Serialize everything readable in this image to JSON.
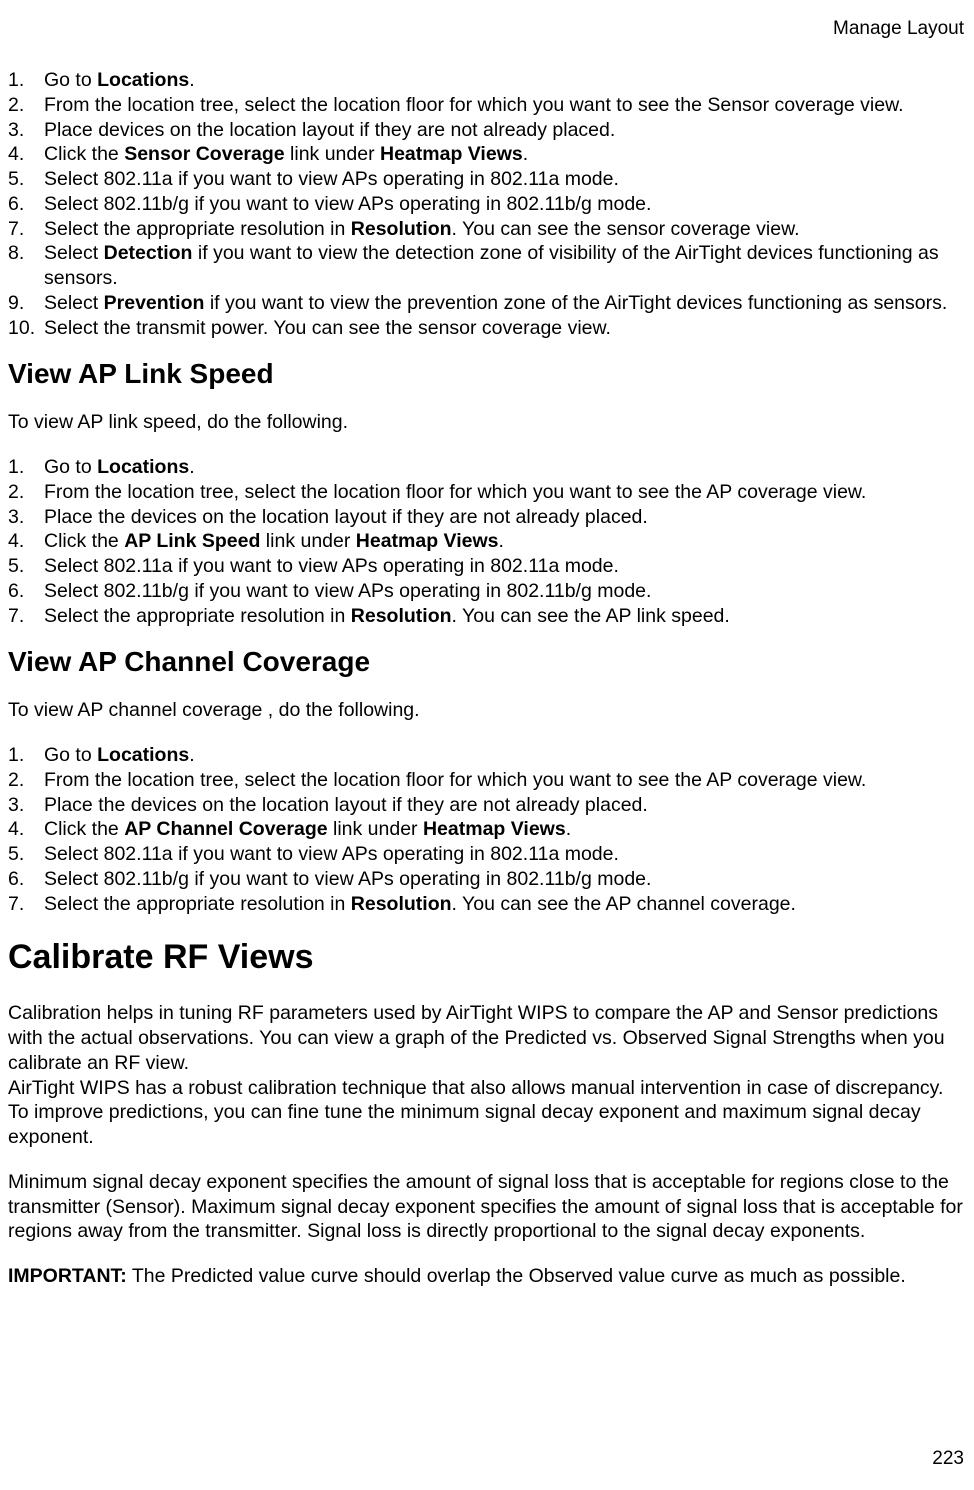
{
  "header": {
    "right": "Manage Layout"
  },
  "list1": {
    "i1": {
      "pre": "Go to ",
      "b": "Locations",
      "post": "."
    },
    "i2": "From the location tree, select the location floor for which you want to see the Sensor coverage view.",
    "i3": "Place devices on the location layout if they are not already placed.",
    "i4": {
      "pre": "Click the ",
      "b1": "Sensor Coverage",
      "mid": " link under ",
      "b2": "Heatmap Views",
      "post": "."
    },
    "i5": "Select 802.11a if you want to view APs operating in 802.11a mode.",
    "i6": "Select 802.11b/g if you want to view APs operating in 802.11b/g mode.",
    "i7": {
      "pre": "Select the appropriate resolution in ",
      "b": "Resolution",
      "post": ". You can see the sensor coverage view."
    },
    "i8": {
      "pre": "Select ",
      "b": "Detection",
      "post": " if you want to view the detection zone of visibility of the AirTight devices functioning as sensors."
    },
    "i9": {
      "pre": "Select ",
      "b": "Prevention",
      "post": " if you want to view the prevention zone of the AirTight devices functioning as sensors."
    },
    "i10": "Select the transmit power. You can see the sensor coverage view."
  },
  "h2_1": "View AP Link Speed",
  "p1": "To view AP link speed, do the following.",
  "list2": {
    "i1": {
      "pre": "Go to ",
      "b": "Locations",
      "post": "."
    },
    "i2": "From the location tree, select the location floor for which you want to see the AP coverage view.",
    "i3": "Place the devices on the location layout if they are not already placed.",
    "i4": {
      "pre": "Click the ",
      "b1": "AP Link Speed",
      "mid": " link under ",
      "b2": "Heatmap Views",
      "post": "."
    },
    "i5": "Select 802.11a if you want to view APs operating in 802.11a mode.",
    "i6": "Select 802.11b/g if you want to view APs operating in 802.11b/g mode.",
    "i7": {
      "pre": "Select the appropriate resolution in ",
      "b": "Resolution",
      "post": ". You can see the AP link speed."
    }
  },
  "h2_2": "View AP Channel Coverage",
  "p2": "To view AP channel coverage , do the following.",
  "list3": {
    "i1": {
      "pre": "Go to ",
      "b": "Locations",
      "post": "."
    },
    "i2": "From the location tree, select the location floor for which you want to see the AP coverage view.",
    "i3": "Place the devices on the location layout if they are not already placed.",
    "i4": {
      "pre": "Click the ",
      "b1": "AP Channel Coverage",
      "mid": " link under ",
      "b2": "Heatmap Views",
      "post": "."
    },
    "i5": "Select 802.11a if you want to view APs operating in 802.11a mode.",
    "i6": "Select 802.11b/g if you want to view APs operating in 802.11b/g mode.",
    "i7": {
      "pre": "Select the appropriate resolution in ",
      "b": "Resolution",
      "post": ". You can see the AP channel coverage."
    }
  },
  "h1": "Calibrate RF Views",
  "p3a": "Calibration helps in tuning RF parameters used by AirTight WIPS to compare the AP and Sensor predictions with the actual observations. You can view a graph of the Predicted vs. Observed Signal Strengths when you calibrate an RF view.",
  "p3b": "AirTight WIPS has a robust calibration technique that also allows manual intervention in case of discrepancy. To improve predictions, you can fine tune the minimum signal decay exponent and maximum signal decay exponent.",
  "p4": "Minimum signal decay exponent specifies the amount of signal loss that is acceptable for regions close to the transmitter (Sensor). Maximum signal decay exponent specifies the amount of signal loss that is acceptable for regions away from the transmitter. Signal loss is directly proportional to the signal decay exponents.",
  "p5": {
    "b": "IMPORTANT:",
    "post": " The Predicted value curve should overlap the Observed value curve as much as possible."
  },
  "pageNum": "223"
}
